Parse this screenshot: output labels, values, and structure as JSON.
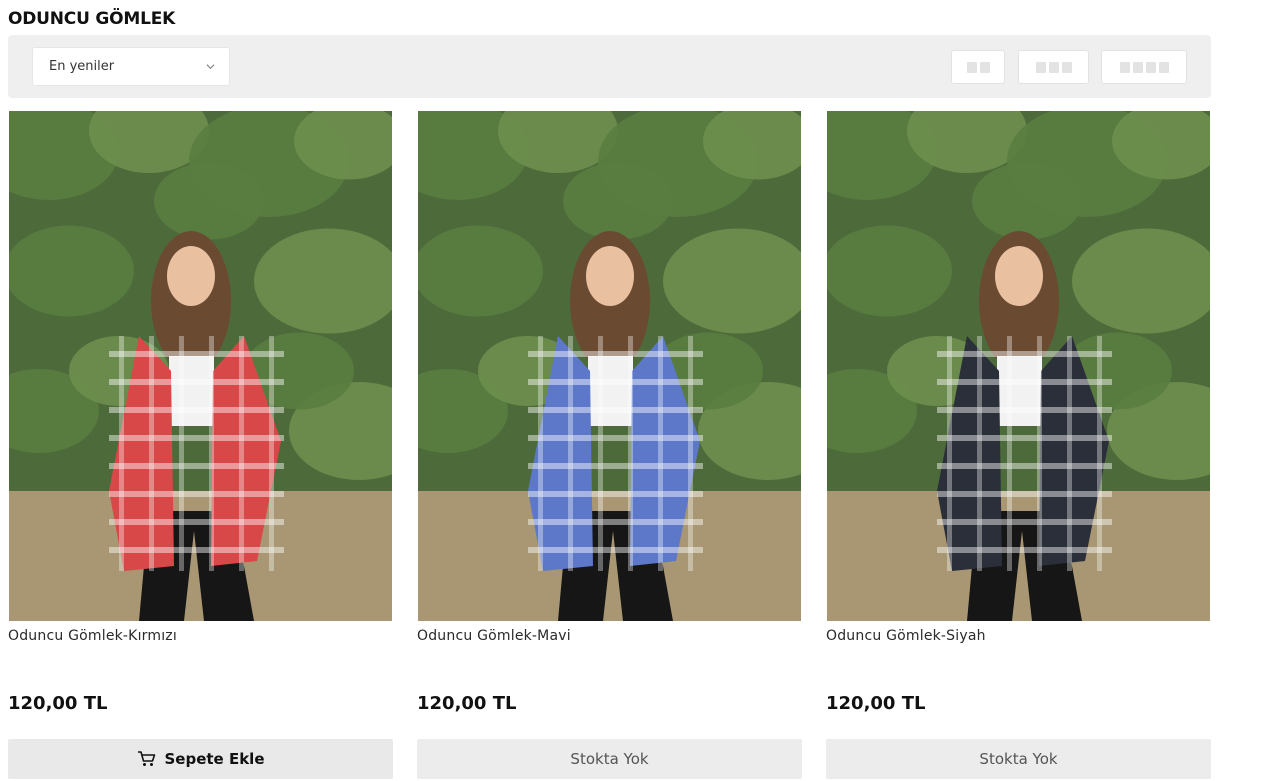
{
  "page": {
    "title": "ODUNCU GÖMLEK"
  },
  "toolbar": {
    "sort_selected": "En yeniler",
    "grid_options": [
      "2-column-grid",
      "3-column-grid",
      "4-column-grid"
    ]
  },
  "products": [
    {
      "name": "Oduncu Gömlek-Kırmızı",
      "price": "120,00 TL",
      "action": "Sepete Ekle",
      "in_stock": true,
      "shirt_color": "#d94848",
      "icon": "shopping-cart-icon"
    },
    {
      "name": "Oduncu Gömlek-Mavi",
      "price": "120,00 TL",
      "action": "Stokta Yok",
      "in_stock": false,
      "shirt_color": "#5d78c8"
    },
    {
      "name": "Oduncu Gömlek-Siyah",
      "price": "120,00 TL",
      "action": "Stokta Yok",
      "in_stock": false,
      "shirt_color": "#2b2f3a"
    }
  ]
}
